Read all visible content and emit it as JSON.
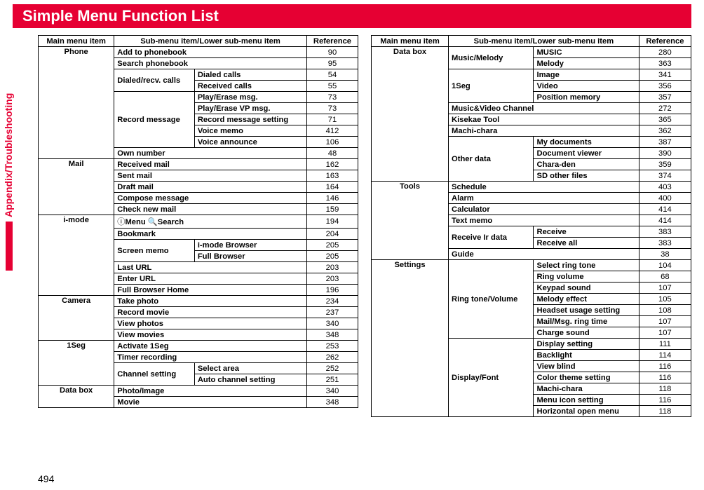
{
  "header_title": "Simple Menu Function List",
  "sidebar_label": "Appendix/Troubleshooting",
  "page_number": "494",
  "table_headers": {
    "main": "Main menu item",
    "sub": "Sub-menu item/Lower sub-menu item",
    "ref": "Reference"
  },
  "left_rows": [
    {
      "main": "Phone",
      "mrs": 10,
      "sub": "Add to phonebook",
      "scs": 2,
      "ref": "90"
    },
    {
      "sub": "Search phonebook",
      "scs": 2,
      "ref": "95"
    },
    {
      "sub": "Dialed/recv. calls",
      "srs": 2,
      "lower": "Dialed calls",
      "ref": "54"
    },
    {
      "lower": "Received calls",
      "ref": "55"
    },
    {
      "sub": "Record message",
      "srs": 5,
      "lower": "Play/Erase msg.",
      "ref": "73"
    },
    {
      "lower": "Play/Erase VP msg.",
      "ref": "73"
    },
    {
      "lower": "Record message setting",
      "ref": "71"
    },
    {
      "lower": "Voice memo",
      "ref": "412"
    },
    {
      "lower": "Voice announce",
      "ref": "106"
    },
    {
      "sub": "Own number",
      "scs": 2,
      "ref": "48"
    },
    {
      "main": "Mail",
      "mrs": 5,
      "sub": "Received mail",
      "scs": 2,
      "ref": "162"
    },
    {
      "sub": "Sent mail",
      "scs": 2,
      "ref": "163"
    },
    {
      "sub": "Draft mail",
      "scs": 2,
      "ref": "164"
    },
    {
      "sub": "Compose message",
      "scs": 2,
      "ref": "146"
    },
    {
      "sub": "Check new mail",
      "scs": 2,
      "ref": "159"
    },
    {
      "main": "i-mode",
      "mrs": 7,
      "sub": "iMenu_Search",
      "scs": 2,
      "ref": "194",
      "special": "imenu"
    },
    {
      "sub": "Bookmark",
      "scs": 2,
      "ref": "204"
    },
    {
      "sub": "Screen memo",
      "srs": 2,
      "lower": "i-mode Browser",
      "ref": "205"
    },
    {
      "lower": "Full Browser",
      "ref": "205"
    },
    {
      "sub": "Last URL",
      "scs": 2,
      "ref": "203"
    },
    {
      "sub": "Enter URL",
      "scs": 2,
      "ref": "203"
    },
    {
      "sub": "Full Browser Home",
      "scs": 2,
      "ref": "196"
    },
    {
      "main": "Camera",
      "mrs": 4,
      "sub": "Take photo",
      "scs": 2,
      "ref": "234"
    },
    {
      "sub": "Record movie",
      "scs": 2,
      "ref": "237"
    },
    {
      "sub": "View photos",
      "scs": 2,
      "ref": "340"
    },
    {
      "sub": "View movies",
      "scs": 2,
      "ref": "348"
    },
    {
      "main": "1Seg",
      "mrs": 4,
      "sub": "Activate 1Seg",
      "scs": 2,
      "ref": "253"
    },
    {
      "sub": "Timer recording",
      "scs": 2,
      "ref": "262"
    },
    {
      "sub": "Channel setting",
      "srs": 2,
      "lower": "Select area",
      "ref": "252"
    },
    {
      "lower": "Auto channel setting",
      "ref": "251"
    },
    {
      "main": "Data box",
      "mrs": 2,
      "sub": "Photo/Image",
      "scs": 2,
      "ref": "340"
    },
    {
      "sub": "Movie",
      "scs": 2,
      "ref": "348"
    }
  ],
  "right_rows": [
    {
      "main": "Data box",
      "mrs": 12,
      "sub": "Music/Melody",
      "srs": 2,
      "lower": "MUSIC",
      "ref": "280"
    },
    {
      "lower": "Melody",
      "ref": "363"
    },
    {
      "sub": "1Seg",
      "srs": 3,
      "lower": "Image",
      "ref": "341"
    },
    {
      "lower": "Video",
      "ref": "356"
    },
    {
      "lower": "Position memory",
      "ref": "357"
    },
    {
      "sub": "Music&Video Channel",
      "scs": 2,
      "ref": "272"
    },
    {
      "sub": "Kisekae Tool",
      "scs": 2,
      "ref": "365"
    },
    {
      "sub": "Machi-chara",
      "scs": 2,
      "ref": "362"
    },
    {
      "sub": "Other data",
      "srs": 4,
      "lower": "My documents",
      "ref": "387"
    },
    {
      "lower": "Document viewer",
      "ref": "390"
    },
    {
      "lower": "Chara-den",
      "ref": "359"
    },
    {
      "lower": "SD other files",
      "ref": "374"
    },
    {
      "main": "Tools",
      "mrs": 7,
      "sub": "Schedule",
      "scs": 2,
      "ref": "403"
    },
    {
      "sub": "Alarm",
      "scs": 2,
      "ref": "400"
    },
    {
      "sub": "Calculator",
      "scs": 2,
      "ref": "414"
    },
    {
      "sub": "Text memo",
      "scs": 2,
      "ref": "414"
    },
    {
      "sub": "Receive Ir data",
      "srs": 2,
      "lower": "Receive",
      "ref": "383"
    },
    {
      "lower": "Receive all",
      "ref": "383"
    },
    {
      "sub": "Guide",
      "scs": 2,
      "ref": "38"
    },
    {
      "main": "Settings",
      "mrs": 14,
      "sub": "Ring tone/Volume",
      "srs": 7,
      "lower": "Select ring tone",
      "ref": "104"
    },
    {
      "lower": "Ring volume",
      "ref": "68"
    },
    {
      "lower": "Keypad sound",
      "ref": "107"
    },
    {
      "lower": "Melody effect",
      "ref": "105"
    },
    {
      "lower": "Headset usage setting",
      "ref": "108"
    },
    {
      "lower": "Mail/Msg. ring time",
      "ref": "107"
    },
    {
      "lower": "Charge sound",
      "ref": "107"
    },
    {
      "sub": "Display/Font",
      "srs": 7,
      "lower": "Display setting",
      "ref": "111"
    },
    {
      "lower": "Backlight",
      "ref": "114"
    },
    {
      "lower": "View blind",
      "ref": "116"
    },
    {
      "lower": "Color theme setting",
      "ref": "116"
    },
    {
      "lower": "Machi-chara",
      "ref": "118"
    },
    {
      "lower": "Menu icon setting",
      "ref": "116"
    },
    {
      "lower": "Horizontal open menu",
      "ref": "118"
    }
  ],
  "imenu_text": {
    "menu": "Menu",
    "search": "Search"
  }
}
